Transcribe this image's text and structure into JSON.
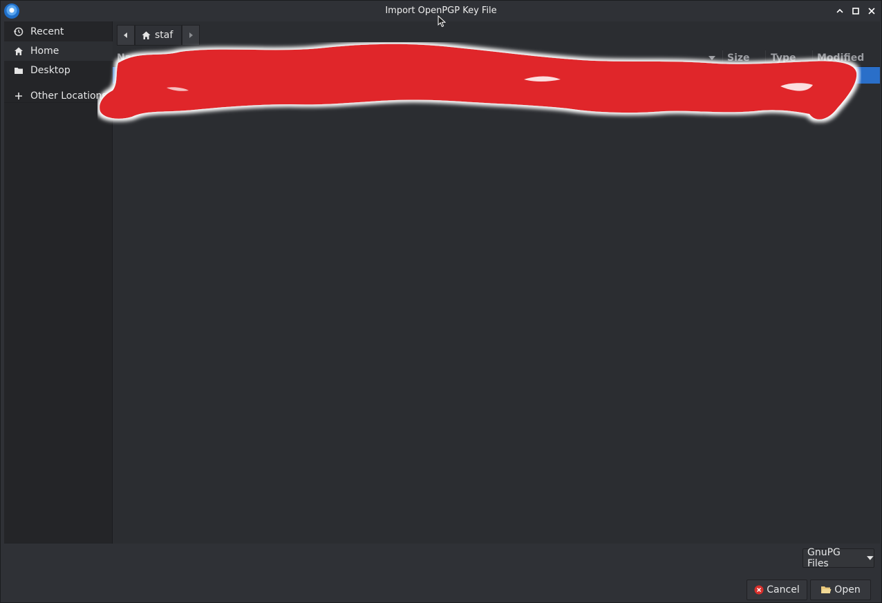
{
  "window": {
    "title": "Import OpenPGP Key File"
  },
  "sidebar": {
    "items": [
      {
        "label": "Recent",
        "icon": "recent-icon"
      },
      {
        "label": "Home",
        "icon": "home-icon"
      },
      {
        "label": "Desktop",
        "icon": "folder-icon"
      },
      {
        "label": "Other Locations",
        "icon": "plus-icon"
      }
    ]
  },
  "pathbar": {
    "current": "staf"
  },
  "file_list": {
    "columns": [
      "Name",
      "Size",
      "Type",
      "Modified"
    ],
    "rows": [
      {
        "name": "",
        "size": "",
        "type": "",
        "modified": "",
        "selected": true
      }
    ]
  },
  "filter": {
    "selected": "GnuPG Files"
  },
  "buttons": {
    "cancel": "Cancel",
    "open": "Open"
  },
  "colors": {
    "selection": "#2a6fc9",
    "redaction": "#e0272a"
  }
}
